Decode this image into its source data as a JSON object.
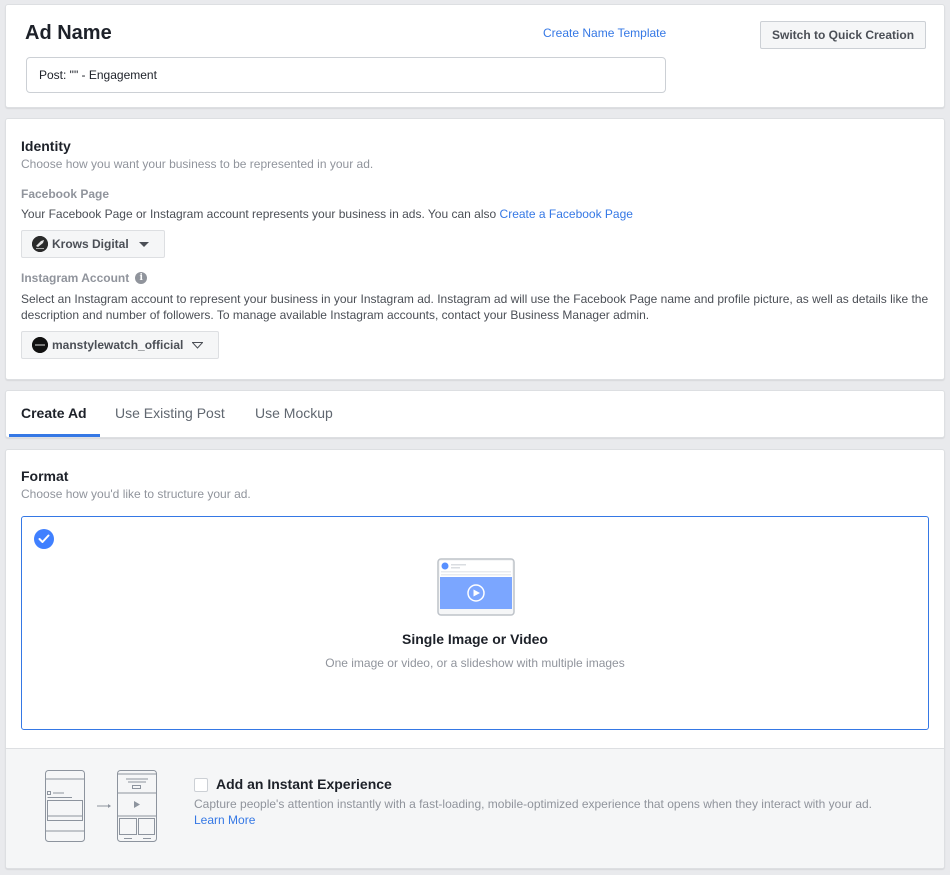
{
  "ad_name": {
    "title": "Ad Name",
    "create_template_link": "Create Name Template",
    "switch_button": "Switch to Quick Creation",
    "input_value": "Post: \"\" - Engagement"
  },
  "identity": {
    "title": "Identity",
    "subtitle": "Choose how you want your business to be represented in your ad.",
    "facebook_page": {
      "label": "Facebook Page",
      "description": "Your Facebook Page or Instagram account represents your business in ads. You can also ",
      "create_link": "Create a Facebook Page",
      "selected": "Krows Digital"
    },
    "instagram_account": {
      "label": "Instagram Account",
      "info_icon": "i",
      "description_line1": "Select an Instagram account to represent your business in your Instagram ad. Instagram ad will use the Facebook Page name and profile picture, as well as details like the",
      "description_line2": "description and number of followers. To manage available Instagram accounts, contact your Business Manager admin.",
      "selected": "manstylewatch_official"
    }
  },
  "tabs": [
    {
      "label": "Create Ad",
      "active": true
    },
    {
      "label": "Use Existing Post",
      "active": false
    },
    {
      "label": "Use Mockup",
      "active": false
    }
  ],
  "format": {
    "title": "Format",
    "subtitle": "Choose how you'd like to structure your ad.",
    "option": {
      "name": "Single Image or Video",
      "description": "One image or video, or a slideshow with multiple images",
      "selected": true
    },
    "instant_experience": {
      "title": "Add an Instant Experience",
      "description": "Capture people's attention instantly with a fast-loading, mobile-optimized experience that opens when they interact with your ad.",
      "learn_more": "Learn More",
      "checked": false
    }
  },
  "colors": {
    "accent": "#3578e5",
    "checkmark": "#4080ff",
    "page_bg": "#e9eaed"
  }
}
